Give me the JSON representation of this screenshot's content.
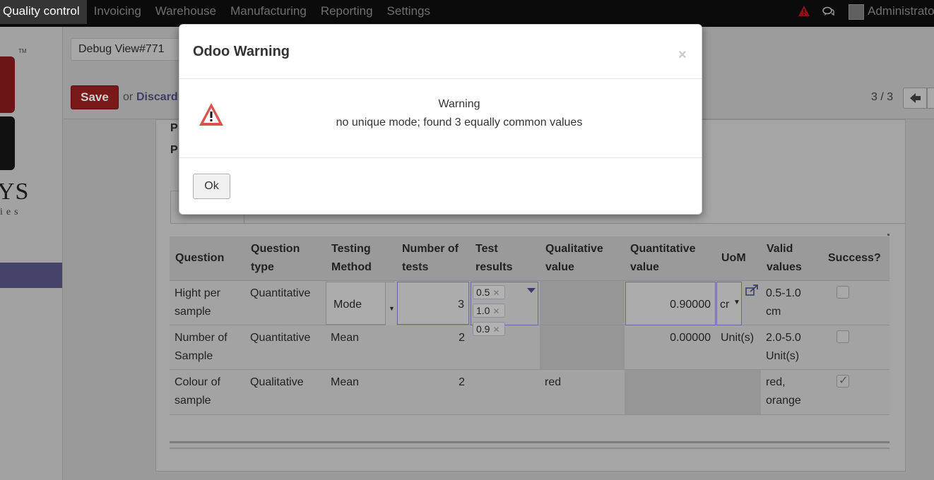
{
  "topbar": {
    "menu": [
      "Quality control",
      "Invoicing",
      "Warehouse",
      "Manufacturing",
      "Reporting",
      "Settings"
    ],
    "user": "Administrator"
  },
  "sidebar": {
    "logo_text": "YS",
    "logo_sub": "ies",
    "logo_tm": "TM"
  },
  "control_panel": {
    "breadcrumb": "Debug View#771",
    "save_label": "Save",
    "or_text": "or",
    "discard_label": "Discard",
    "pager": "3 / 3"
  },
  "form": {
    "label_1": "P",
    "label_2": "P"
  },
  "table": {
    "headers": [
      "Question",
      "Question type",
      "Testing Method",
      "Number of tests",
      "Test results",
      "Qualitative value",
      "Quantitative value",
      "UoM",
      "Valid values",
      "Success?"
    ],
    "rows": [
      {
        "question": "Hight per sample",
        "question_type": "Quantitative",
        "testing_method": "Mode",
        "number_of_tests": "3",
        "test_results": [
          "0.5",
          "1.0",
          "0.9"
        ],
        "qualitative_value": "",
        "quantitative_value": "0.90000",
        "uom": "cr",
        "valid_values": "0.5-1.0 cm",
        "success": false
      },
      {
        "question": "Number of Sample",
        "question_type": "Quantitative",
        "testing_method": "Mean",
        "number_of_tests": "2",
        "test_results": [],
        "qualitative_value": "",
        "quantitative_value": "0.00000",
        "uom": "Unit(s)",
        "valid_values": "2.0-5.0 Unit(s)",
        "success": false
      },
      {
        "question": "Colour of sample",
        "question_type": "Qualitative",
        "testing_method": "Mean",
        "number_of_tests": "2",
        "test_results": [],
        "qualitative_value": "red",
        "quantitative_value": "",
        "uom": "",
        "valid_values": "red, orange",
        "success": true
      }
    ]
  },
  "modal": {
    "title": "Odoo Warning",
    "close": "×",
    "warning_title": "Warning",
    "warning_message": "no unique mode; found 3 equally common values",
    "ok_label": "Ok"
  },
  "colors": {
    "topbar_bg": "#0b0b0b",
    "save_button": "#7a1919",
    "warning_red": "#d9534f",
    "link": "#3e3e66"
  },
  "icons": {
    "topbar_alert": "warning-triangle-icon",
    "topbar_chat": "chat-bubbles-icon",
    "modal_warning": "warning-triangle-icon",
    "external_link": "external-link-icon"
  }
}
